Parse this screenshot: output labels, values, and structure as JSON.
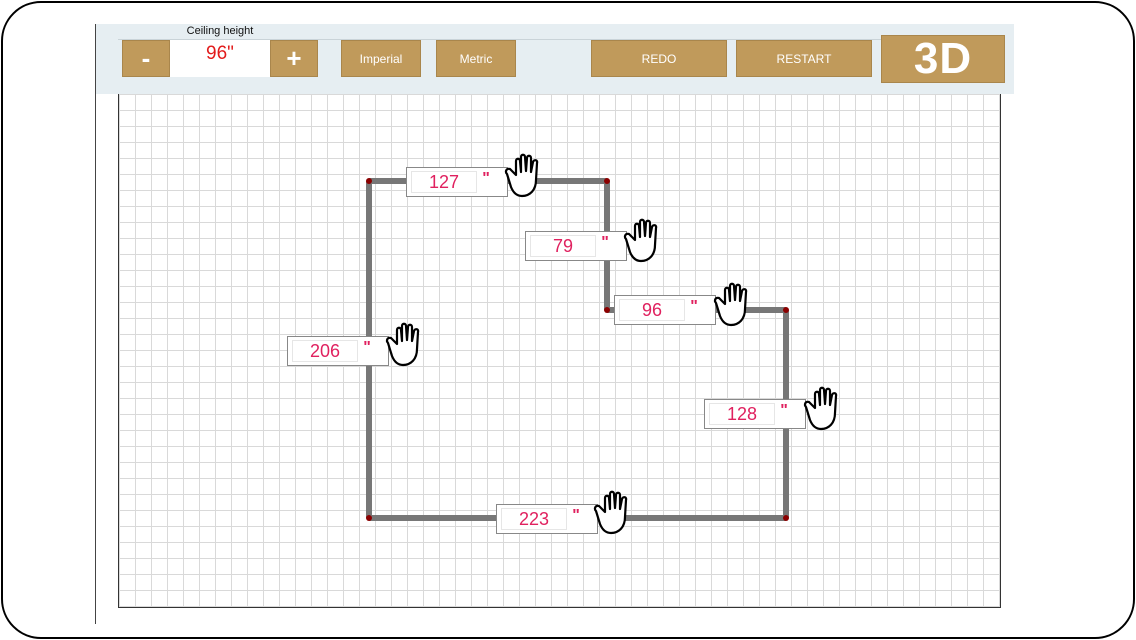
{
  "toolbar": {
    "minus_label": "-",
    "plus_label": "+",
    "ceiling_label": "Ceiling height",
    "ceiling_value": "96\"",
    "imperial_label": "Imperial",
    "metric_label": "Metric",
    "redo_label": "REDO",
    "restart_label": "RESTART",
    "view3d_label": "3D"
  },
  "walls": [
    {
      "id": "top",
      "value": "127",
      "unit": "\""
    },
    {
      "id": "upper-right-vertical",
      "value": "79",
      "unit": "\""
    },
    {
      "id": "middle-horizontal",
      "value": "96",
      "unit": "\""
    },
    {
      "id": "left",
      "value": "206",
      "unit": "\""
    },
    {
      "id": "right",
      "value": "128",
      "unit": "\""
    },
    {
      "id": "bottom",
      "value": "223",
      "unit": "\""
    }
  ],
  "colors": {
    "button": "#c09a5b",
    "dimension_text": "#e0215f",
    "ceiling_text": "#e21b1b",
    "wall": "#777777",
    "corner": "#8b0000"
  },
  "icons": {
    "drag_handle": "hand-grab-icon"
  }
}
